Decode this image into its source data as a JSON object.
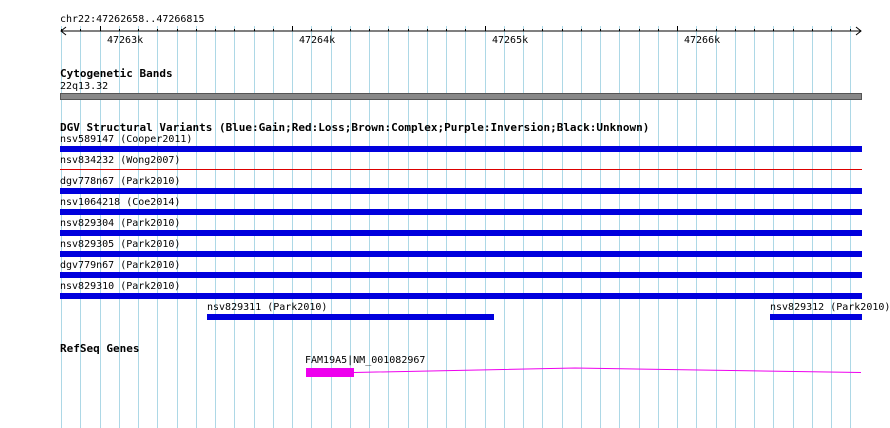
{
  "ruler": {
    "region": "chr22:47262658..47266815",
    "ticks": [
      "47263k",
      "47264k",
      "47265k",
      "47266k"
    ]
  },
  "cytogenetic": {
    "title": "Cytogenetic Bands",
    "band": "22q13.32",
    "band_color": "#888888"
  },
  "dgv": {
    "title": "DGV Structural Variants (Blue:Gain;Red:Loss;Brown:Complex;Purple:Inversion;Black:Unknown)",
    "colors": {
      "gain": "#0000dd",
      "loss": "#dd0000"
    },
    "variants": [
      {
        "label": "nsv589147 (Cooper2011)",
        "type": "gain"
      },
      {
        "label": "nsv834232 (Wong2007)",
        "type": "loss"
      },
      {
        "label": "dgv778n67 (Park2010)",
        "type": "gain"
      },
      {
        "label": "nsv1064218 (Coe2014)",
        "type": "gain"
      },
      {
        "label": "nsv829304 (Park2010)",
        "type": "gain"
      },
      {
        "label": "nsv829305 (Park2010)",
        "type": "gain"
      },
      {
        "label": "dgv779n67 (Park2010)",
        "type": "gain"
      },
      {
        "label": "nsv829310 (Park2010)",
        "type": "gain"
      }
    ],
    "partial": [
      {
        "label": "nsv829311 (Park2010)",
        "type": "gain"
      },
      {
        "label": "nsv829312 (Park2010)",
        "type": "gain"
      }
    ]
  },
  "refseq": {
    "title": "RefSeq Genes",
    "gene_label": "FAM19A5|NM_001082967",
    "color": "#ee00ee"
  }
}
